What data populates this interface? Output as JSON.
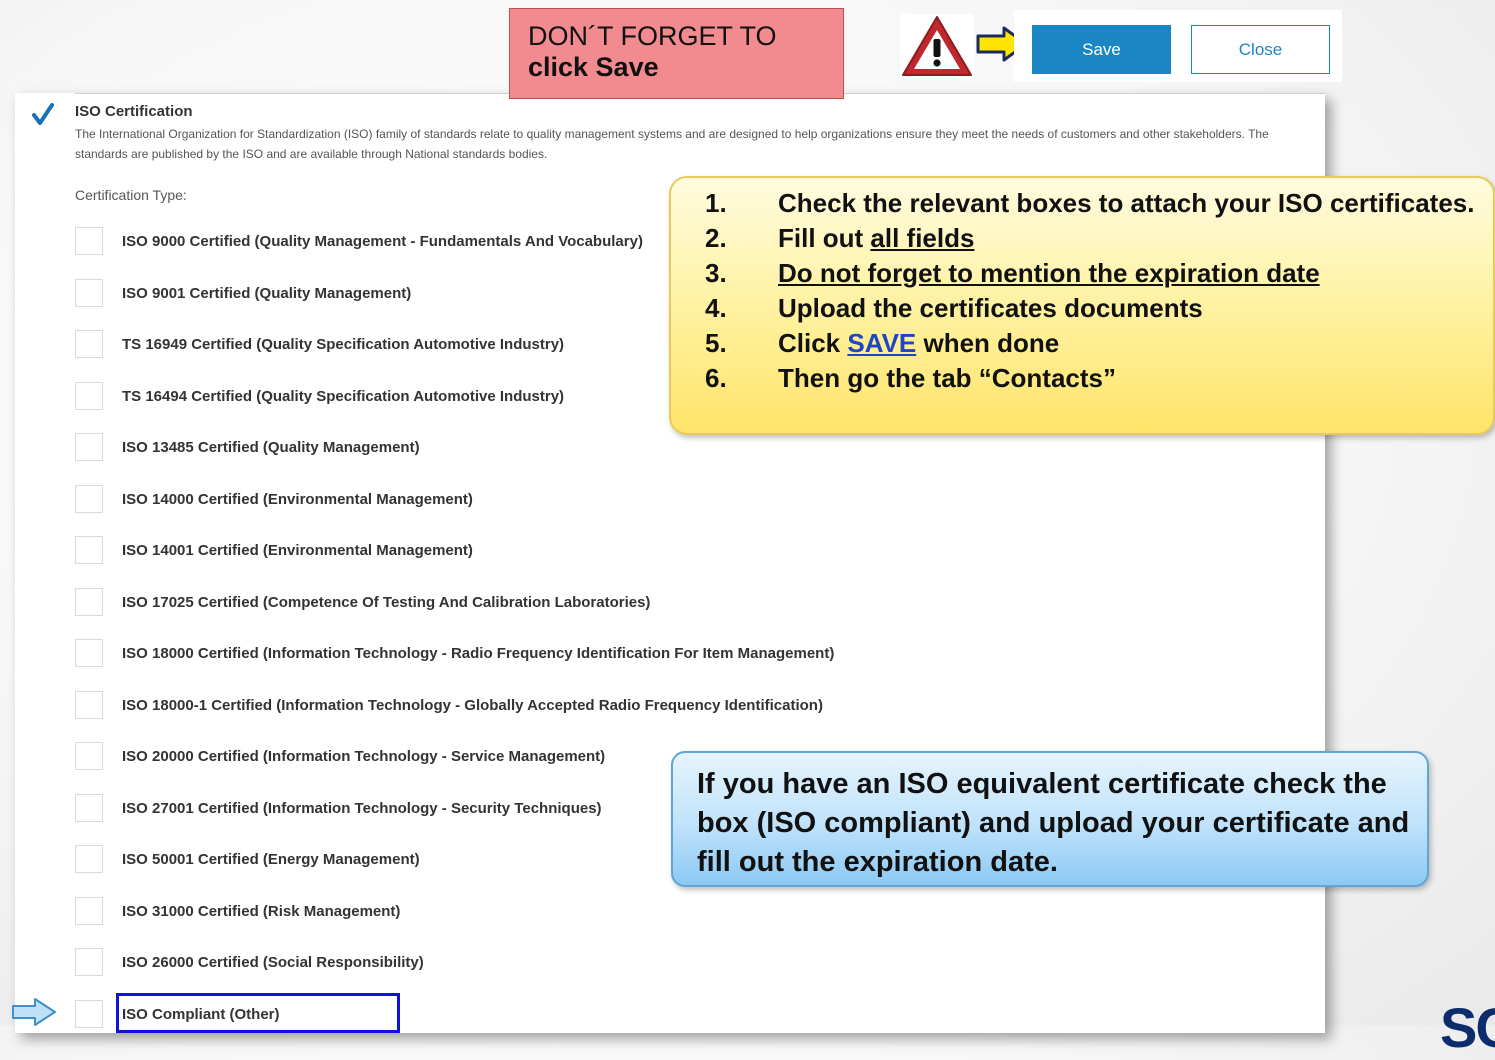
{
  "reminder": {
    "line1": "DON´T FORGET TO",
    "line2": "click Save"
  },
  "toolbar": {
    "save_label": "Save",
    "close_label": "Close"
  },
  "section": {
    "title": "ISO Certification",
    "checked": true,
    "description": "The International Organization for Standardization (ISO) family of standards relate to quality management systems and are designed to help organizations ensure they meet the needs of customers and other stakeholders. The standards are published by the ISO and are available through National standards bodies.",
    "certification_type_label": "Certification Type:"
  },
  "certifications": [
    {
      "label": "ISO 9000 Certified (Quality Management - Fundamentals And Vocabulary)"
    },
    {
      "label": "ISO 9001 Certified (Quality Management)"
    },
    {
      "label": "TS 16949 Certified (Quality Specification Automotive Industry)"
    },
    {
      "label": "TS 16494 Certified (Quality Specification Automotive Industry)"
    },
    {
      "label": "ISO 13485 Certified (Quality Management)"
    },
    {
      "label": "ISO 14000 Certified (Environmental Management)"
    },
    {
      "label": "ISO 14001 Certified (Environmental Management)"
    },
    {
      "label": "ISO 17025 Certified (Competence Of Testing And Calibration Laboratories)"
    },
    {
      "label": "ISO 18000 Certified (Information Technology - Radio Frequency Identification For Item Management)"
    },
    {
      "label": "ISO 18000-1 Certified (Information Technology - Globally Accepted Radio Frequency Identification)"
    },
    {
      "label": "ISO 20000 Certified (Information Technology - Service Management)"
    },
    {
      "label": "ISO 27001 Certified (Information Technology - Security Techniques)"
    },
    {
      "label": "ISO 50001 Certified (Energy Management)"
    },
    {
      "label": "ISO 31000 Certified (Risk Management)"
    },
    {
      "label": "ISO 26000 Certified (Social Responsibility)"
    },
    {
      "label": "ISO Compliant (Other)"
    }
  ],
  "steps_callout": {
    "steps": [
      {
        "num": "1.",
        "text_a": "Check the relevant boxes to attach your ISO certificates."
      },
      {
        "num": "2.",
        "text_a": "Fill out ",
        "text_u": "all fields"
      },
      {
        "num": "3.",
        "text_u": "Do not forget to mention the expiration date"
      },
      {
        "num": "4.",
        "text_a": "Upload the certificates documents"
      },
      {
        "num": "5.",
        "text_a": "Click ",
        "link": "SAVE",
        "text_b": " when done"
      },
      {
        "num": "6.",
        "text_a": "Then go the tab “Contacts”"
      }
    ]
  },
  "iso_callout": {
    "text": "If you have an ISO equivalent certificate check the box (ISO compliant) and upload your certificate and fill out the expiration date."
  },
  "colors": {
    "accent": "#1a86c3",
    "reminder_bg": "#f28b8f",
    "steps_bg": "#fff3a8",
    "iso_callout_bg": "#bfe2fb",
    "highlight_border": "#1111dd"
  },
  "icons": {
    "warning": "warning-triangle-icon",
    "arrow": "right-arrow-icon",
    "pointer": "pointer-arrow-icon",
    "check": "checkmark-icon"
  }
}
